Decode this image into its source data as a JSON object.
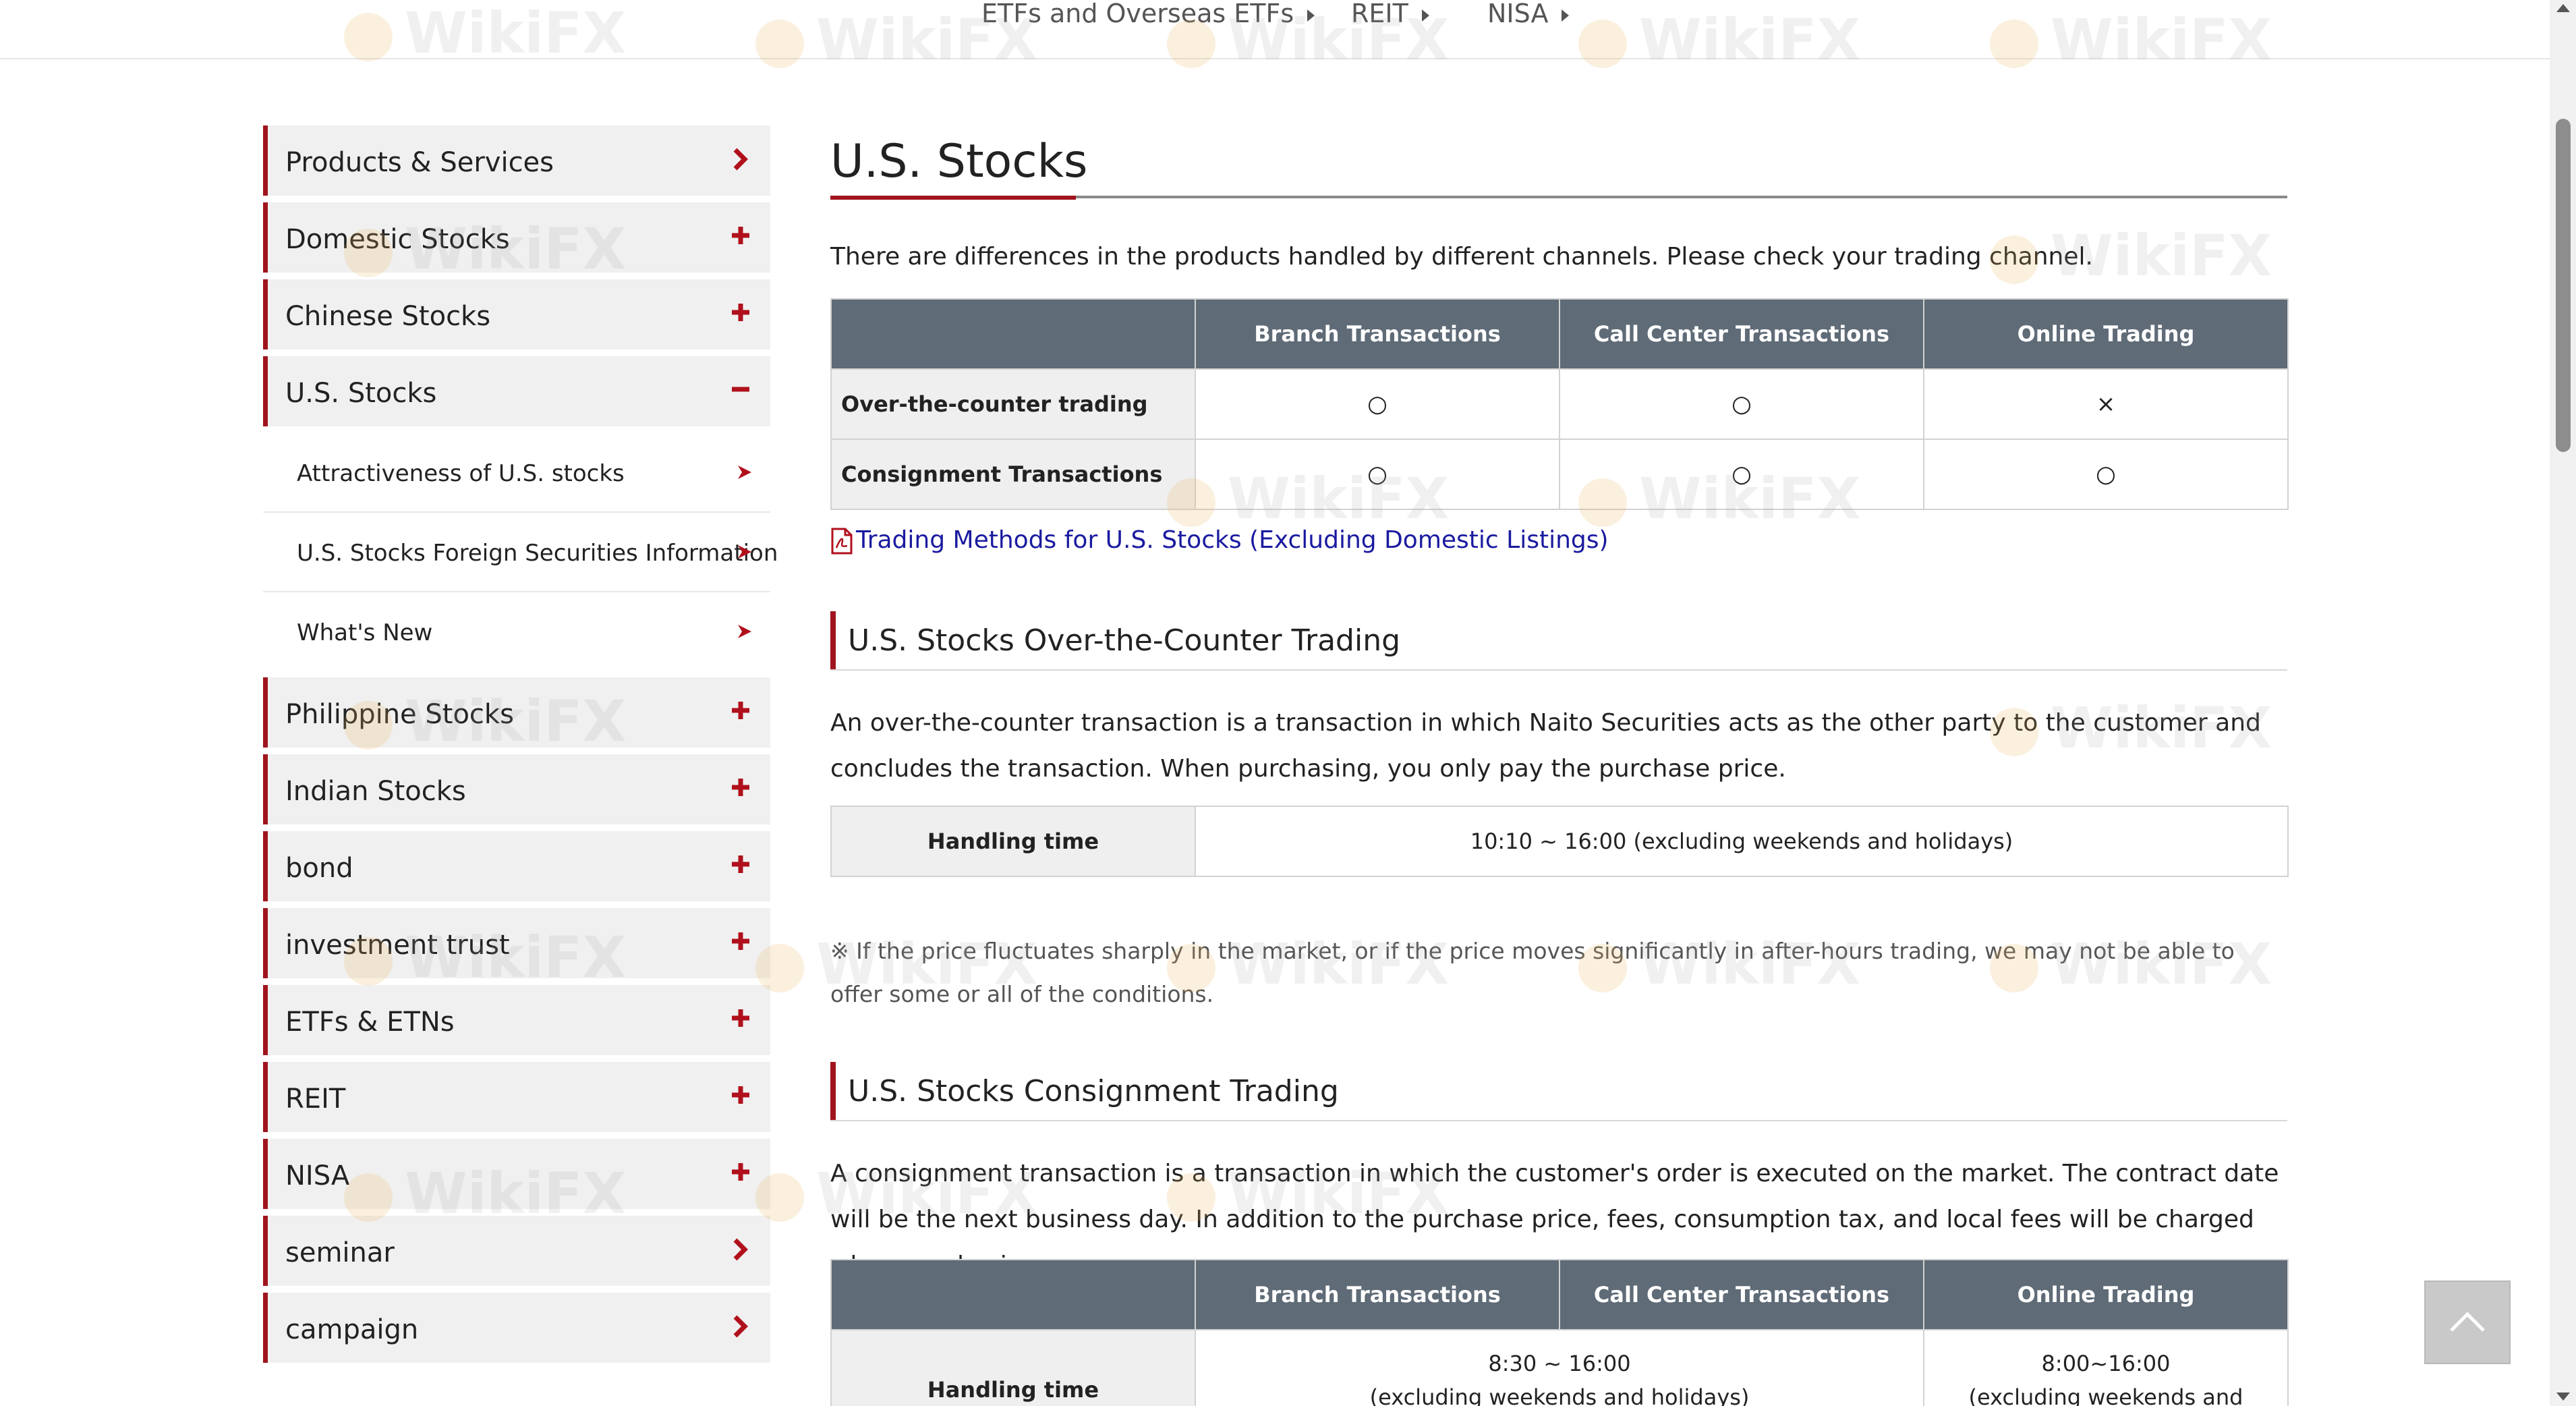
{
  "topnav": {
    "items": [
      {
        "label": "ETFs and Overseas ETFs"
      },
      {
        "label": "REIT"
      },
      {
        "label": "NISA"
      }
    ]
  },
  "sidebar": {
    "items": [
      {
        "label": "Products & Services",
        "icon": "chevron-right-icon"
      },
      {
        "label": "Domestic Stocks",
        "icon": "plus-icon"
      },
      {
        "label": "Chinese Stocks",
        "icon": "plus-icon"
      },
      {
        "label": "U.S. Stocks",
        "icon": "minus-icon"
      }
    ],
    "subitems": [
      {
        "label": "Attractiveness of U.S. stocks"
      },
      {
        "label": "U.S. Stocks Foreign Securities Information"
      },
      {
        "label": "What's New"
      }
    ],
    "items_after": [
      {
        "label": "Philippine Stocks",
        "icon": "plus-icon"
      },
      {
        "label": "Indian Stocks",
        "icon": "plus-icon"
      },
      {
        "label": "bond",
        "icon": "plus-icon"
      },
      {
        "label": "investment trust",
        "icon": "plus-icon"
      },
      {
        "label": "ETFs & ETNs",
        "icon": "plus-icon"
      },
      {
        "label": "REIT",
        "icon": "plus-icon"
      },
      {
        "label": "NISA",
        "icon": "plus-icon"
      },
      {
        "label": "seminar",
        "icon": "chevron-right-icon"
      },
      {
        "label": "campaign",
        "icon": "chevron-right-icon"
      }
    ]
  },
  "main": {
    "title": "U.S. Stocks",
    "intro": "There are differences in the products handled by different channels. Please check your trading channel.",
    "channels_table": {
      "headers": [
        "",
        "Branch Transactions",
        "Call Center Transactions",
        "Online Trading"
      ],
      "rows": [
        {
          "label": "Over-the-counter trading",
          "values": [
            "○",
            "○",
            "×"
          ]
        },
        {
          "label": "Consignment Transactions",
          "values": [
            "○",
            "○",
            "○"
          ]
        }
      ]
    },
    "pdf_link": "Trading Methods for U.S. Stocks (Excluding Domestic Listings)",
    "otc_section": {
      "heading": "U.S. Stocks Over-the-Counter Trading",
      "description": "An over-the-counter transaction is a transaction in which Naito Securities acts as the other party to the customer and concludes the transaction. When purchasing, you only pay the purchase price.",
      "table": {
        "label": "Handling time",
        "value": "10:10 ~ 16:00 (excluding weekends and holidays)"
      },
      "note": "※ If the price fluctuates sharply in the market, or if the price moves significantly in after-hours trading, we may not be able to offer some or all of the conditions."
    },
    "consignment_section": {
      "heading": "U.S. Stocks Consignment Trading",
      "description": "A consignment transaction is a transaction in which the customer's order is executed on the market. The contract date will be the next business day. In addition to the purchase price, fees, consumption tax, and local fees will be charged when purchasing.",
      "table": {
        "headers": [
          "",
          "Branch Transactions",
          "Call Center Transactions",
          "Online Trading"
        ],
        "row_label": "Handling time",
        "branch_callcenter_time": "8:30 ~ 16:00",
        "branch_callcenter_note": "(excluding weekends and holidays)",
        "online_time": "8:00~16:00",
        "online_note": "(excluding weekends and holidays)"
      }
    }
  },
  "watermark": "WikiFX",
  "colors": {
    "accent": "#a0141e",
    "table_header": "#5f6b77",
    "link": "#1a1aa0"
  }
}
